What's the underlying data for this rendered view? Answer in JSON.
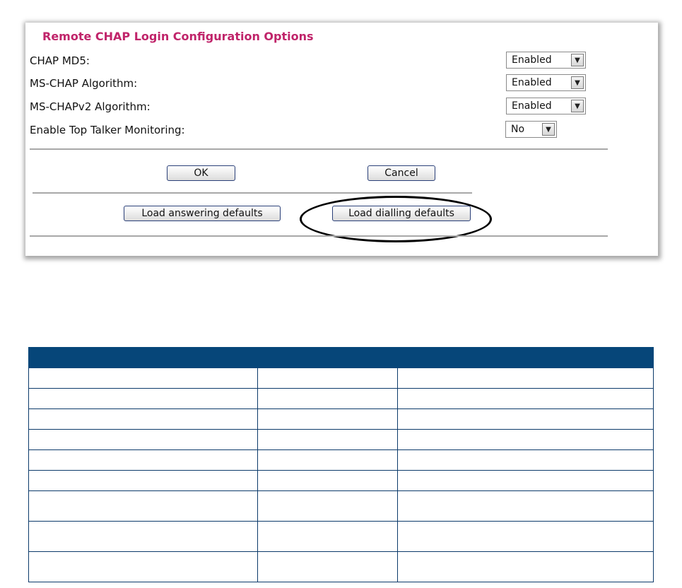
{
  "panel": {
    "title": "Remote CHAP Login Configuration Options",
    "options": [
      {
        "label": "CHAP MD5:",
        "value": "Enabled"
      },
      {
        "label": "MS-CHAP Algorithm:",
        "value": "Enabled"
      },
      {
        "label": "MS-CHAPv2 Algorithm:",
        "value": "Enabled"
      },
      {
        "label": "Enable Top Talker Monitoring:",
        "value": "No"
      }
    ],
    "buttons": {
      "ok": "OK",
      "cancel": "Cancel",
      "load_answering": "Load answering defaults",
      "load_dialling": "Load dialling defaults"
    }
  },
  "colors": {
    "title": "#c0246a",
    "table_header": "#064679",
    "table_border": "#0c3a6a"
  },
  "icons": {
    "dropdown": "chevron-down-icon"
  }
}
